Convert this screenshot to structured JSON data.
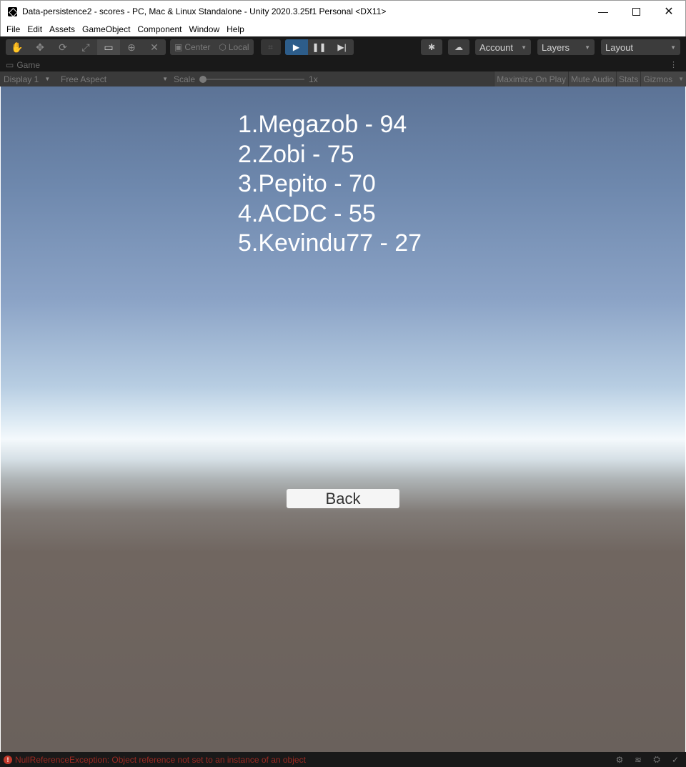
{
  "window": {
    "title": "Data-persistence2 - scores - PC, Mac & Linux Standalone - Unity 2020.3.25f1 Personal <DX11>",
    "minimize_glyph": "—",
    "close_glyph": "✕"
  },
  "menu": [
    "File",
    "Edit",
    "Assets",
    "GameObject",
    "Component",
    "Window",
    "Help"
  ],
  "toolbar": {
    "tool_icons": [
      "hand-icon",
      "move-icon",
      "rotate-icon",
      "scale-icon",
      "rect-icon",
      "transform-icon",
      "custom-tool-icon"
    ],
    "tool_glyphs": [
      "✋",
      "✥",
      "⟳",
      "⤢",
      "▭",
      "⊕",
      "✕"
    ],
    "pivot_label": "Center",
    "pivot_glyph": "▣",
    "space_label": "Local",
    "space_glyph": "⬡",
    "snap_glyph": "⌗",
    "play_glyph": "▶",
    "pause_glyph": "❚❚",
    "step_glyph": "▶|",
    "collab_glyph": "✱",
    "cloud_glyph": "☁",
    "account_label": "Account",
    "layers_label": "Layers",
    "layout_label": "Layout",
    "caret_glyph": "▼"
  },
  "game_tab": {
    "label": "Game",
    "tab_glyph": "▭",
    "more_glyph": "⋮"
  },
  "game_bar": {
    "display": "Display 1",
    "aspect": "Free Aspect",
    "scale_label": "Scale",
    "scale_value": "1x",
    "maximize_on_play": "Maximize On Play",
    "mute_audio": "Mute Audio",
    "stats": "Stats",
    "gizmos": "Gizmos"
  },
  "scores": [
    "1.Megazob - 94",
    "2.Zobi - 75",
    "3.Pepito - 70",
    "4.ACDC - 55",
    "5.Kevindu77 - 27"
  ],
  "back_button": "Back",
  "status": {
    "error_glyph": "!",
    "error_message": "NullReferenceException: Object reference not set to an instance of an object",
    "icon_glyphs": [
      "⚙",
      "≋",
      "⛭",
      "✓"
    ]
  },
  "colors": {
    "toolbar_bg": "#191919",
    "play_active": "#2d5d8a",
    "sky_top": "#5c7396",
    "ground": "#6a615c",
    "error": "#9b2a22"
  }
}
